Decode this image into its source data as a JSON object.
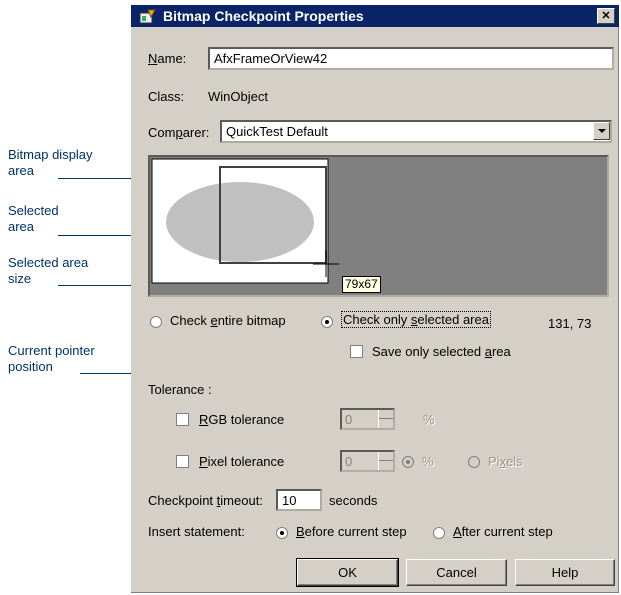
{
  "annotations": {
    "bitmap_display_area": [
      "Bitmap display",
      "area"
    ],
    "selected_area": [
      "Selected",
      "area"
    ],
    "selected_area_size": [
      "Selected area",
      "size"
    ],
    "current_pointer_position": [
      "Current pointer",
      "position"
    ]
  },
  "dialog": {
    "title": "Bitmap Checkpoint Properties",
    "close_glyph": "✕",
    "title_icon": "bitmap-checkpoint-icon",
    "name_label": "Name:",
    "name_value": "AfxFrameOrView42",
    "class_label": "Class:",
    "class_value": "WinObject",
    "comparer_label": "Comparer:",
    "comparer_value": "QuickTest Default",
    "selected_size_tooltip": "79x67",
    "check_entire_label": "Check entire bitmap",
    "check_selected_label": "Check only selected area",
    "pointer_position": "131, 73",
    "save_selected_label": "Save only selected area",
    "tolerance_label": "Tolerance :",
    "rgb_tolerance_label": "RGB tolerance",
    "rgb_tolerance_value": "0",
    "rgb_unit": "%",
    "pixel_tolerance_label": "Pixel tolerance",
    "pixel_tolerance_value": "0",
    "pixel_unit_percent": "%",
    "pixel_unit_pixels": "Pixels",
    "timeout_label": "Checkpoint timeout:",
    "timeout_value": "10",
    "timeout_unit": "seconds",
    "insert_label": "Insert statement:",
    "before_label": "Before current step",
    "after_label": "After current step",
    "ok_label": "OK",
    "cancel_label": "Cancel",
    "help_label": "Help"
  },
  "colors": {
    "titlebar": "#0a246a",
    "dialog_face": "#d4d0c8",
    "annotation_text": "#003366",
    "bitmap_background": "#808080",
    "ellipse": "#c0c0c0",
    "tooltip": "#ffffe1"
  }
}
